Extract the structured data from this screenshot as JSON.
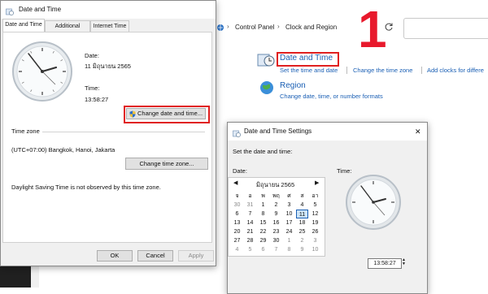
{
  "control_panel": {
    "breadcrumb": [
      "Control Panel",
      "Clock and Region"
    ],
    "date_time": {
      "title": "Date and Time",
      "links": [
        "Set the time and date",
        "Change the time zone",
        "Add clocks for differe"
      ]
    },
    "region": {
      "title": "Region",
      "link": "Change date, time, or number formats"
    }
  },
  "annotations": {
    "step1": "1",
    "step2": "2",
    "step3": "3"
  },
  "dialog_main": {
    "title": "Date and Time",
    "tabs": [
      "Date and Time",
      "Additional Clocks",
      "Internet Time"
    ],
    "date_label": "Date:",
    "date_value": "11 มิถุนายน 2565",
    "time_label": "Time:",
    "time_value": "13:58:27",
    "change_datetime_button": "Change date and time...",
    "timezone_header": "Time zone",
    "timezone_value": "(UTC+07:00) Bangkok, Hanoi, Jakarta",
    "change_timezone_button": "Change time zone...",
    "dst_note": "Daylight Saving Time is not observed by this time zone.",
    "ok": "OK",
    "cancel": "Cancel",
    "apply": "Apply"
  },
  "dialog_settings": {
    "title": "Date and Time Settings",
    "instruction": "Set the date and time:",
    "date_label": "Date:",
    "time_label": "Time:",
    "month_label": "มิถุนายน 2565",
    "weekdays": [
      "จ",
      "อ",
      "พ",
      "พฤ",
      "ศ",
      "ส",
      "อา"
    ],
    "weeks": [
      [
        "30",
        "31",
        "1",
        "2",
        "3",
        "4",
        "5"
      ],
      [
        "6",
        "7",
        "8",
        "9",
        "10",
        "11",
        "12"
      ],
      [
        "13",
        "14",
        "15",
        "16",
        "17",
        "18",
        "19"
      ],
      [
        "20",
        "21",
        "22",
        "23",
        "24",
        "25",
        "26"
      ],
      [
        "27",
        "28",
        "29",
        "30",
        "1",
        "2",
        "3"
      ],
      [
        "4",
        "5",
        "6",
        "7",
        "8",
        "9",
        "10"
      ]
    ],
    "selected_day": "11",
    "time_value": "13:58:27",
    "close": "✕"
  },
  "colors": {
    "accent": "#1a5fb4",
    "annotation": "#e8192c",
    "highlight_box": "#e02020"
  },
  "icons": [
    "datetime-icon",
    "region-globe-icon",
    "refresh-icon",
    "shield-icon",
    "clock-face-icon",
    "close-icon",
    "chevron-left-icon",
    "chevron-right-icon",
    "spin-up-icon",
    "spin-down-icon"
  ]
}
